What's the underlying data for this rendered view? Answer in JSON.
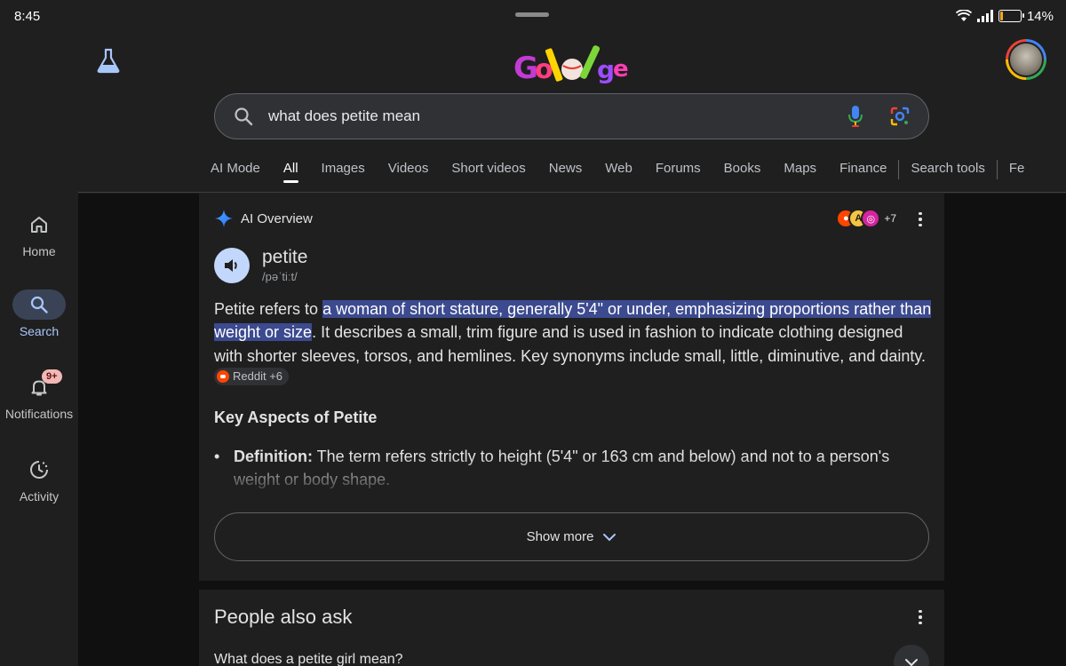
{
  "status_bar": {
    "time": "8:45",
    "battery": "14%",
    "battery_level": 0.14
  },
  "header": {
    "doodle_alt": "Google"
  },
  "search": {
    "query": "what does petite mean"
  },
  "tabs": [
    "AI Mode",
    "All",
    "Images",
    "Videos",
    "Short videos",
    "News",
    "Web",
    "Forums",
    "Books",
    "Maps",
    "Finance",
    "Search tools",
    "Fe"
  ],
  "active_tab": "All",
  "side_nav": {
    "home": "Home",
    "search": "Search",
    "notifications": "Notifications",
    "notifications_badge": "9+",
    "activity": "Activity"
  },
  "ai_overview": {
    "label": "AI Overview",
    "sources_more": "+7",
    "word": "petite",
    "phonetic": "/pəˈtiːt/",
    "text_before": "Petite refers to ",
    "text_highlight": "a woman of short stature, generally 5'4\" or under, emphasizing proportions rather than weight or size",
    "text_after": ". It describes a small, trim figure and is used in fashion to indicate clothing designed with shorter sleeves, torsos, and hemlines. Key synonyms include small, little, diminutive, and dainty.",
    "chip": "Reddit +6",
    "key_heading": "Key Aspects of Petite",
    "bullet_title": "Definition:",
    "bullet_text": " The term refers strictly to height (5'4\" or 163 cm and below) and not to a person's weight or body shape.",
    "show_more": "Show more"
  },
  "people_also_ask": {
    "title": "People also ask",
    "question_1": "What does a petite girl mean?"
  },
  "colors": {
    "background": "#1f1f1f",
    "highlight": "#3c4a8f",
    "active_nav": "#a8c7fa"
  }
}
